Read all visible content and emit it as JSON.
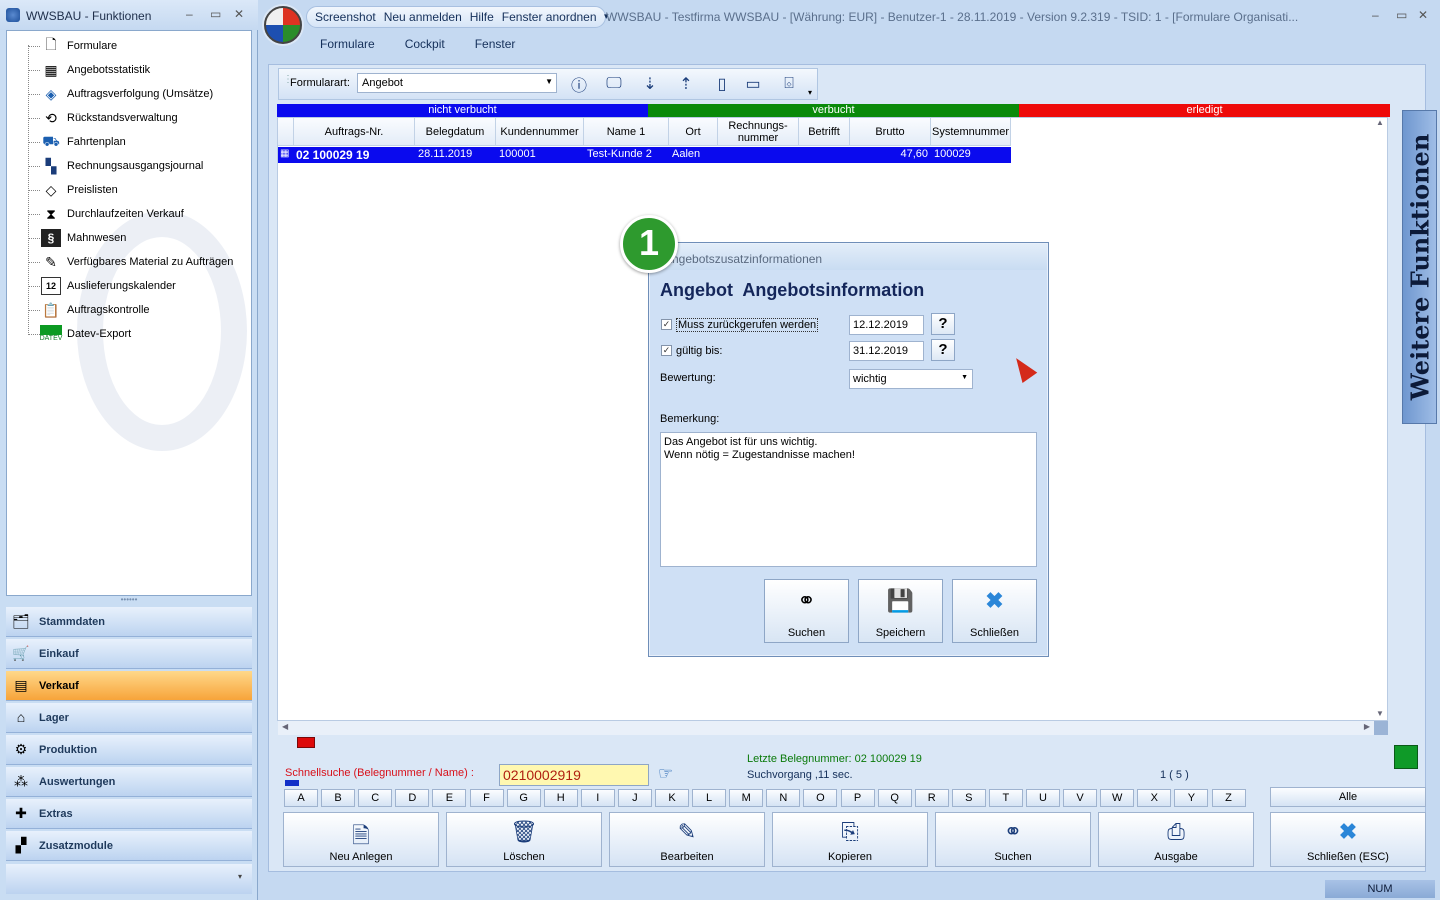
{
  "left_window": {
    "title": "WWSBAU - Funktionen",
    "tree": [
      {
        "label": "Formulare",
        "icon": "document-icon"
      },
      {
        "label": "Angebotsstatistik",
        "icon": "statistics-icon"
      },
      {
        "label": "Auftragsverfolgung (Umsätze)",
        "icon": "tracking-icon"
      },
      {
        "label": "Rückstandsverwaltung",
        "icon": "backlog-icon"
      },
      {
        "label": "Fahrtenplan",
        "icon": "truck-icon"
      },
      {
        "label": "Rechnungsausgangsjournal",
        "icon": "journal-icon"
      },
      {
        "label": "Preislisten",
        "icon": "pricetag-icon"
      },
      {
        "label": "Durchlaufzeiten Verkauf",
        "icon": "hourglass-icon"
      },
      {
        "label": "Mahnwesen",
        "icon": "dunning-icon"
      },
      {
        "label": "Verfügbares Material zu Aufträgen",
        "icon": "material-icon"
      },
      {
        "label": "Auslieferungskalender",
        "icon": "calendar-icon"
      },
      {
        "label": "Auftragskontrolle",
        "icon": "clipboard-icon"
      },
      {
        "label": "Datev-Export",
        "icon": "datev-icon"
      }
    ],
    "calendar_icon_text": "12",
    "datev_icon_text": "DATEV",
    "nav": [
      {
        "label": "Stammdaten",
        "icon": "masterdata-icon",
        "active": false
      },
      {
        "label": "Einkauf",
        "icon": "cart-icon",
        "active": false
      },
      {
        "label": "Verkauf",
        "icon": "cashregister-icon",
        "active": true
      },
      {
        "label": "Lager",
        "icon": "warehouse-icon",
        "active": false
      },
      {
        "label": "Produktion",
        "icon": "production-icon",
        "active": false
      },
      {
        "label": "Auswertungen",
        "icon": "analysis-icon",
        "active": false
      },
      {
        "label": "Extras",
        "icon": "extras-icon",
        "active": false
      },
      {
        "label": "Zusatzmodule",
        "icon": "modules-icon",
        "active": false
      }
    ]
  },
  "main_window": {
    "title": "WWSBAU - Testfirma WWSBAU - [Währung: EUR] - Benutzer-1 - 28.11.2019 - Version 9.2.319 - TSID: 1  - [Formulare Organisati...",
    "quick_access": [
      "Screenshot",
      "Neu anmelden",
      "Hilfe",
      "Fenster anordnen"
    ],
    "menu": [
      "Formulare",
      "Cockpit",
      "Fenster"
    ]
  },
  "toolbar": {
    "label": "Formularart:",
    "selected": "Angebot"
  },
  "status_bars": [
    {
      "label": "nicht verbucht",
      "color": "#0a0aee"
    },
    {
      "label": "verbucht",
      "color": "#0a8a0a"
    },
    {
      "label": "erledigt",
      "color": "#ee0a0a"
    }
  ],
  "grid": {
    "columns": [
      "Auftrags-Nr.",
      "Belegdatum",
      "Kundennummer",
      "Name 1",
      "Ort",
      "Rechnungs-\nnummer",
      "Betrifft",
      "Brutto",
      "Systemnummer"
    ],
    "rows": [
      {
        "auftrag": "02 100029 19",
        "datum": "28.11.2019",
        "kunde": "100001",
        "name": "Test-Kunde 2",
        "ort": "Aalen",
        "rechnung": "",
        "betrifft": "",
        "brutto": "47,60",
        "system": "100029"
      }
    ]
  },
  "dialog": {
    "title": "Angebotszusatzinformationen",
    "heading": "Angebot  Angebotsinformation",
    "badge": "1",
    "muss_label": "Muss zurückgerufen werden",
    "muss_checked": true,
    "muss_date": "12.12.2019",
    "gueltig_label": "gültig bis:",
    "gueltig_checked": true,
    "gueltig_date": "31.12.2019",
    "help_label": "?",
    "bewertung_label": "Bewertung:",
    "bewertung_value": "wichtig",
    "bemerkung_label": "Bemerkung:",
    "bemerkung_line1": "Das Angebot ist für uns wichtig.",
    "bemerkung_line2": "Wenn nötig = Zugestandnisse machen!",
    "buttons": [
      {
        "label": "Suchen",
        "icon": "binoculars-icon"
      },
      {
        "label": "Speichern",
        "icon": "save-icon"
      },
      {
        "label": "Schließen",
        "icon": "close-icon"
      }
    ]
  },
  "side_tab": "Weitere Funktionen",
  "bottom": {
    "quick_search_label": "Schnellsuche (Belegnummer / Name) :",
    "quick_search_value": "0210002919",
    "last_number": "Letzte Belegnummer: 02 100029 19",
    "search_time": "Suchvorgang ,11 sec.",
    "page_count": "1  ( 5 )",
    "letters": [
      "A",
      "B",
      "C",
      "D",
      "E",
      "F",
      "G",
      "H",
      "I",
      "J",
      "K",
      "L",
      "M",
      "N",
      "O",
      "P",
      "Q",
      "R",
      "S",
      "T",
      "U",
      "V",
      "W",
      "X",
      "Y",
      "Z"
    ],
    "all_label": "Alle",
    "buttons": [
      {
        "label": "Neu Anlegen",
        "icon": "new-document-icon"
      },
      {
        "label": "Löschen",
        "icon": "trash-icon"
      },
      {
        "label": "Bearbeiten",
        "icon": "edit-icon"
      },
      {
        "label": "Kopieren",
        "icon": "copy-icon"
      },
      {
        "label": "Suchen",
        "icon": "binoculars-icon"
      },
      {
        "label": "Ausgabe",
        "icon": "printer-icon"
      },
      {
        "label": "Schließen (ESC)",
        "icon": "close-icon"
      }
    ]
  },
  "statusbar": {
    "num": "NUM"
  }
}
